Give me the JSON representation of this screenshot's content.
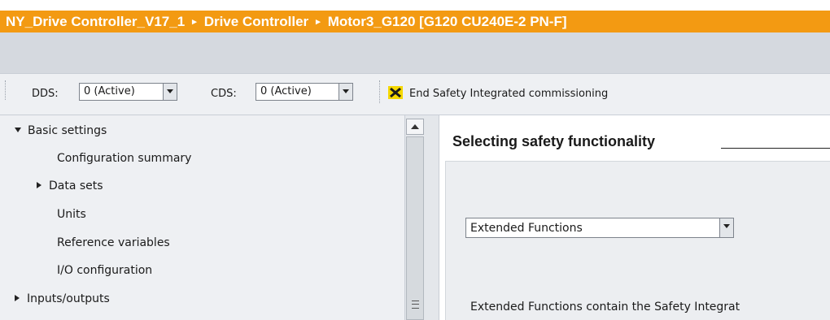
{
  "breadcrumb": {
    "items": [
      "NY_Drive Controller_V17_1",
      "Drive Controller",
      "Motor3_G120 [G120 CU240E-2 PN-F]"
    ],
    "separator": "▸"
  },
  "toolbar": {
    "dds_label": "DDS:",
    "dds_value": "0 (Active)",
    "cds_label": "CDS:",
    "cds_value": "0 (Active)",
    "end_safety_label": "End Safety Integrated commissioning"
  },
  "tree": {
    "basic_settings": "Basic settings",
    "configuration_summary": "Configuration summary",
    "data_sets": "Data sets",
    "units": "Units",
    "reference_variables": "Reference variables",
    "io_configuration": "I/O configuration",
    "inputs_outputs": "Inputs/outputs"
  },
  "section": {
    "title": "Selecting safety functionality",
    "functions_select_value": "Extended Functions",
    "description": "Extended Functions contain the Safety Integrat"
  },
  "colors": {
    "breadcrumb_bg": "#f39a12",
    "toolbar_bg": "#eef0f3",
    "icon_yellow": "#f5d800"
  }
}
